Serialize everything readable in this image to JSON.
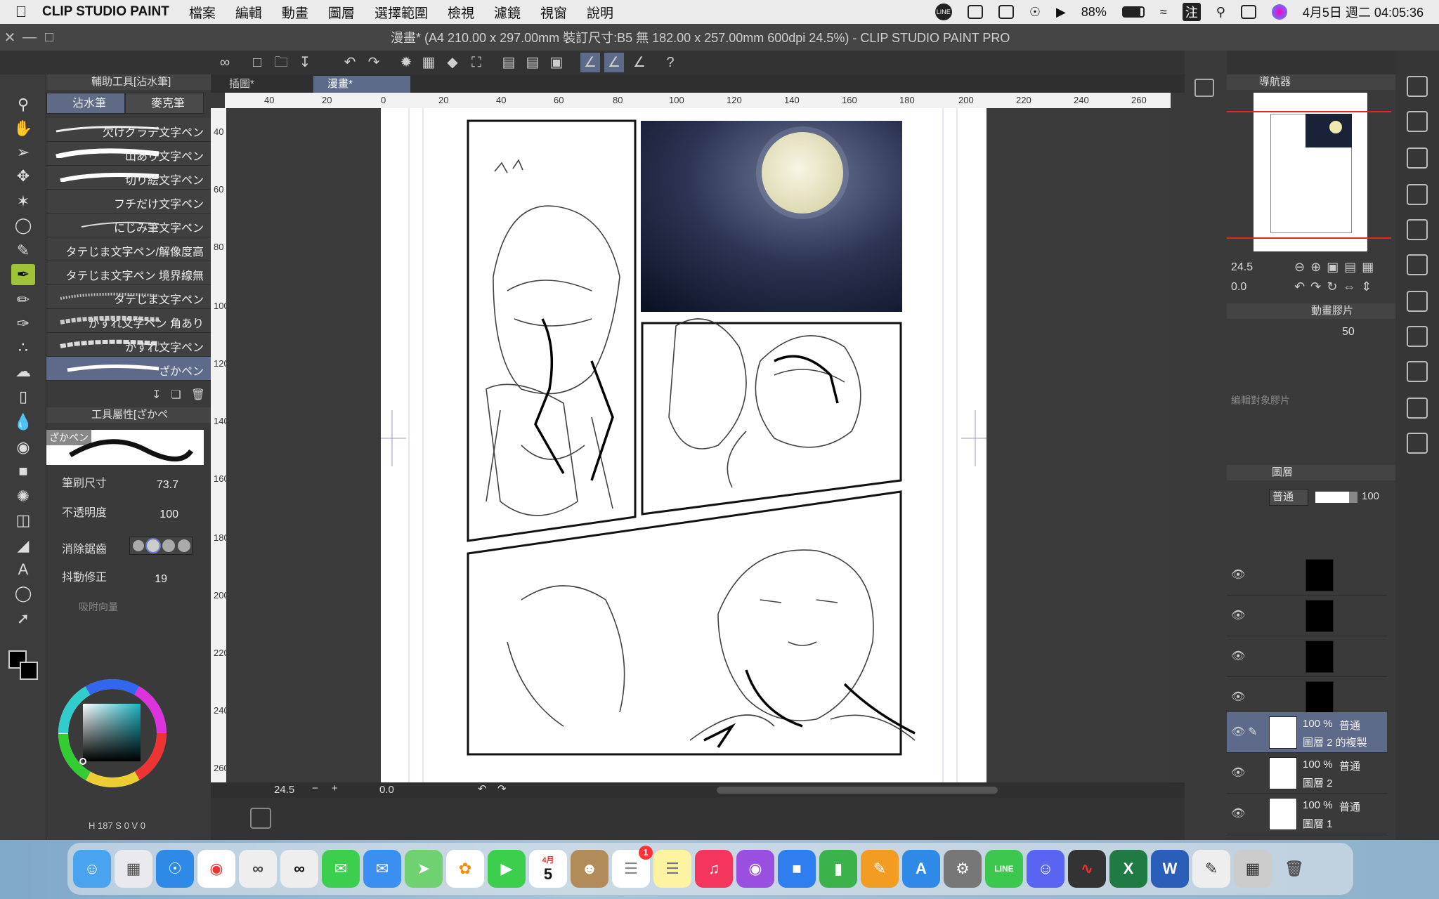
{
  "menubar": {
    "app": "CLIP STUDIO PAINT",
    "items": [
      "檔案",
      "編輯",
      "動畫",
      "圖層",
      "選擇範圍",
      "檢視",
      "濾鏡",
      "視窗",
      "說明"
    ],
    "battery": "88%",
    "input_method": "注",
    "datetime": "4月5日 週二 04:05:36"
  },
  "window": {
    "title": "漫畫* (A4 210.00 x 297.00mm 裝訂尺寸:B5 無 182.00 x 257.00mm 600dpi 24.5%) - CLIP STUDIO PAINT PRO"
  },
  "subtool": {
    "header": "輔助工具[沾水筆]",
    "tabs": [
      "沾水筆",
      "麥克筆"
    ],
    "brushes": [
      "欠けグラデ文字ペン",
      "山あり文字ペン",
      "切り絵文字ペン",
      "フチだけ文字ペン",
      "にじみ筆文字ペン",
      "タテじま文字ペン/解像度高",
      "タテじま文字ペン 境界線無",
      "タテじま文字ペン",
      "かすれ文字ペン 角あり",
      "かすれ文字ペン",
      "ざかペン"
    ]
  },
  "toolprop": {
    "header": "工具屬性[ざかペ",
    "preview_label": "ざかペン",
    "brush_size_label": "筆刷尺寸",
    "brush_size": "73.7",
    "opacity_label": "不透明度",
    "opacity": "100",
    "aa_label": "消除鋸齒",
    "stab_label": "抖動修正",
    "stab": "19",
    "snap_label": "吸附向量"
  },
  "color": {
    "hsv": "H 187 S 0 V 0",
    "main": "#000000",
    "sub": "#000000"
  },
  "doc_tabs": [
    "插圖*",
    "漫畫*"
  ],
  "ruler": {
    "h": [
      "40",
      "20",
      "0",
      "20",
      "40",
      "60",
      "80",
      "100",
      "120",
      "140",
      "160",
      "180",
      "200",
      "220",
      "240",
      "260"
    ],
    "v": [
      "40",
      "60",
      "80",
      "100",
      "120",
      "140",
      "160",
      "180",
      "200",
      "220",
      "240",
      "260"
    ]
  },
  "statusbar": {
    "zoom": "24.5",
    "angle": "0.0"
  },
  "navigator": {
    "title": "導航器",
    "zoom": "24.5",
    "angle": "0.0"
  },
  "animation": {
    "title": "動畫膠片",
    "opacity": "50",
    "placeholder": "編輯對象膠片"
  },
  "layers": {
    "title": "圖層",
    "blend": "普通",
    "opacity": "100",
    "items": [
      {
        "pct": "100 %",
        "mode": "普通",
        "name": "圖層 2 的複製"
      },
      {
        "pct": "100 %",
        "mode": "普通",
        "name": "圖層 2"
      },
      {
        "pct": "100 %",
        "mode": "普通",
        "name": "圖層 1"
      }
    ]
  },
  "dock": {
    "calendar_month": "4月",
    "calendar_day": "5",
    "reminders_badge": "1"
  }
}
